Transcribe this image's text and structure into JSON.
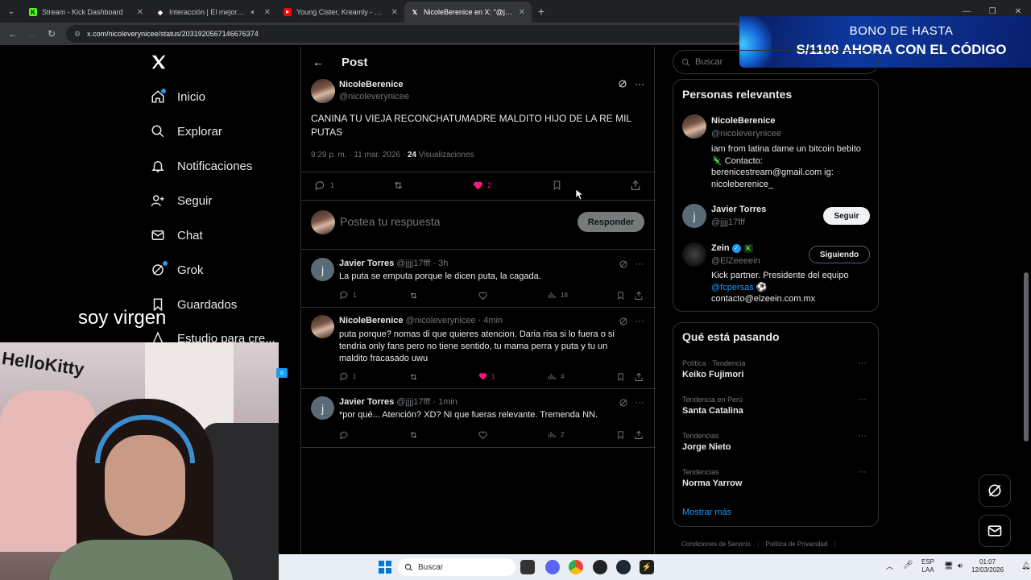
{
  "browser": {
    "tabs": [
      {
        "label": "Stream - Kick Dashboard",
        "fav_color": "#53fc18",
        "fav_glyph": "K"
      },
      {
        "label": "Interacción | El mejor softw",
        "fav_color": "#ffffff",
        "fav_glyph": "◆"
      },
      {
        "label": "Young Cister, Kreamly - QLOO",
        "fav_color": "#ff0000",
        "fav_glyph": "▶"
      },
      {
        "label": "NicoleBerenice en X: \"@jjjj17ff",
        "fav_color": "#000000",
        "fav_glyph": "𝕏"
      }
    ],
    "url": "x.com/nicoleverynicee/status/2031920567146676374"
  },
  "ad": {
    "line1": "BONO DE HASTA",
    "line2": "S/1100 AHORA CON EL CÓDIGO"
  },
  "nav": {
    "items": [
      {
        "label": "Inicio",
        "icon": "home-icon"
      },
      {
        "label": "Explorar",
        "icon": "search-icon"
      },
      {
        "label": "Notificaciones",
        "icon": "bell-icon"
      },
      {
        "label": "Seguir",
        "icon": "follow-icon"
      },
      {
        "label": "Chat",
        "icon": "mail-icon"
      },
      {
        "label": "Grok",
        "icon": "grok-icon"
      },
      {
        "label": "Guardados",
        "icon": "bookmark-icon"
      },
      {
        "label": "Estudio para cre...",
        "icon": "studio-icon"
      }
    ]
  },
  "post": {
    "header": "Post",
    "author_name": "NicoleBerenice",
    "author_handle": "@nicoleverynicee",
    "text": "CANINA TU VIEJA RECONCHATUMADRE MALDITO HIJO DE LA RE MIL PUTAS",
    "time": "9:29 p. m. · 11 mar. 2026 · ",
    "views_count": "24",
    "views_label": "Visualizaciones",
    "replies": "1",
    "likes": "2",
    "reply_placeholder": "Postea tu respuesta",
    "reply_button": "Responder"
  },
  "replies": [
    {
      "name": "Javier Torres",
      "handle": "@jjjj17fff · 3h",
      "text": "La puta se emputa porque le dicen puta, la cagada.",
      "replies": "1",
      "likes": "",
      "views": "18",
      "avatar": "j"
    },
    {
      "name": "NicoleBerenice",
      "handle": "@nicoleverynicee · 4min",
      "text": "puta porque? nomas di que quieres atencion. Daria risa si lo fuera o si tendria only fans pero no tiene sentido, tu mama perra y puta y tu un maldito fracasado uwu",
      "replies": "1",
      "likes": "1",
      "views": "4",
      "avatar": "photo"
    },
    {
      "name": "Javier Torres",
      "handle": "@jjjj17fff · 1min",
      "text": "*por qué... Atención? XD? Ni que fueras relevante. Tremenda NN.",
      "replies": "",
      "likes": "",
      "views": "2",
      "avatar": "j"
    }
  ],
  "sidebar": {
    "search_placeholder": "Buscar",
    "relevant_title": "Personas relevantes",
    "people": [
      {
        "name": "NicoleBerenice",
        "handle": "@nicoleverynicee",
        "bio": "iam from latina dame un bitcoin bebito 🦎 Contacto: berenicestream@gmail.com ig: nicoleberenice_"
      },
      {
        "name": "Javier Torres",
        "handle": "@jjjj17fff",
        "button": "Seguir"
      },
      {
        "name": "Zein",
        "handle": "@ElZeeeein",
        "button": "Siguiendo",
        "bio_pre": "Kick partner. Presidente del equipo ",
        "bio_link": "@fcpersas",
        "bio_post": " ⚽ contacto@elzeein.com.mx"
      }
    ],
    "trending_title": "Qué está pasando",
    "trends": [
      {
        "context": "Política · Tendencia",
        "name": "Keiko Fujimori"
      },
      {
        "context": "Tendencia en Perú",
        "name": "Santa Catalina"
      },
      {
        "context": "Tendencias",
        "name": "Jorge Nieto"
      },
      {
        "context": "Tendencias",
        "name": "Norma Yarrow"
      }
    ],
    "show_more": "Mostrar más",
    "footer": [
      "Condiciones de Servicio",
      "Política de Privacidad"
    ]
  },
  "overlay": {
    "caption": "soy virgen",
    "hk_text": "HelloKitty"
  },
  "taskbar": {
    "search": "Buscar",
    "lang_1": "ESP",
    "lang_2": "LAA",
    "time": "01:07",
    "date": "12/03/2026"
  },
  "colors": {
    "like_pink": "#f91880",
    "accent_blue": "#1d9bf0",
    "kick_green": "#53fc18"
  }
}
